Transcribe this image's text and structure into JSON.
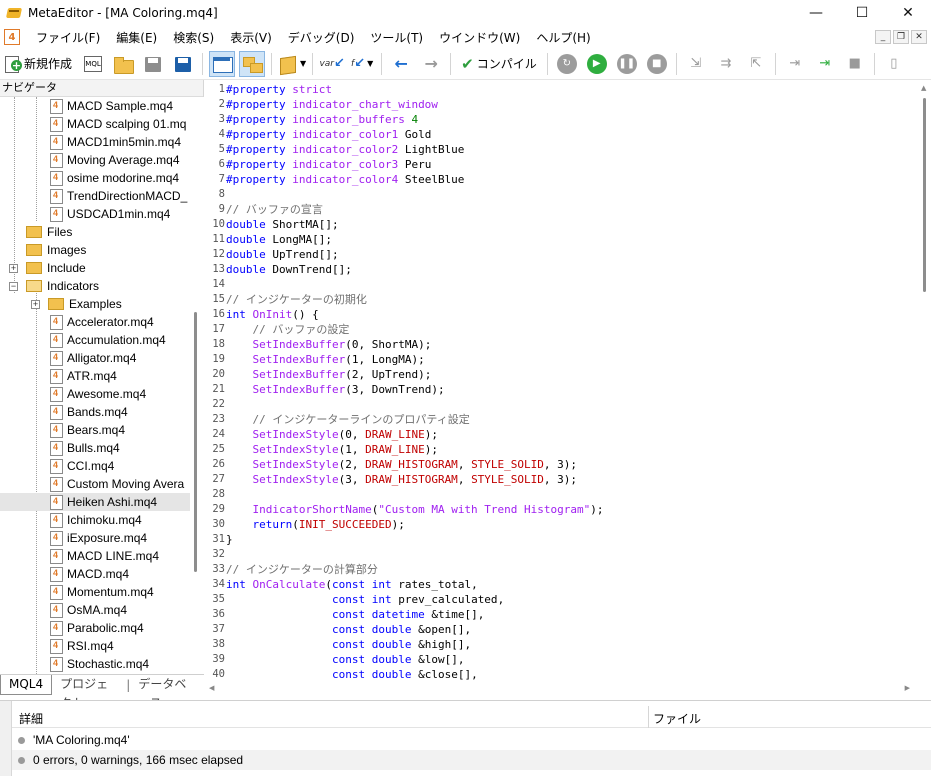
{
  "window": {
    "title": "MetaEditor - [MA Coloring.mq4]",
    "controls": {
      "minimize": "—",
      "maximize": "☐",
      "close": "✕"
    }
  },
  "menubar": {
    "items": [
      "ファイル(F)",
      "編集(E)",
      "検索(S)",
      "表示(V)",
      "デバッグ(D)",
      "ツール(T)",
      "ウインドウ(W)",
      "ヘルプ(H)"
    ],
    "mdi": {
      "minimize": "_",
      "restore": "❐",
      "close": "✕"
    }
  },
  "toolbar": {
    "new_label": "新規作成",
    "mq_label": "MQL",
    "var_label": "var",
    "func_label": "f",
    "compile_label": "コンパイル"
  },
  "navigator": {
    "header": "ナビゲータ",
    "top_files": [
      "MACD Sample.mq4",
      "MACD scalping 01.mq",
      "MACD1min5min.mq4",
      "Moving Average.mq4",
      "osime modorine.mq4",
      "TrendDirectionMACD_",
      "USDCAD1min.mq4"
    ],
    "folders": [
      "Files",
      "Images",
      "Include",
      "Indicators"
    ],
    "subfolder": "Examples",
    "indicator_files": [
      "Accelerator.mq4",
      "Accumulation.mq4",
      "Alligator.mq4",
      "ATR.mq4",
      "Awesome.mq4",
      "Bands.mq4",
      "Bears.mq4",
      "Bulls.mq4",
      "CCI.mq4",
      "Custom Moving Avera",
      "Heiken Ashi.mq4",
      "Ichimoku.mq4",
      "iExposure.mq4",
      "MACD LINE.mq4",
      "MACD.mq4",
      "Momentum.mq4",
      "OsMA.mq4",
      "Parabolic.mq4",
      "RSI.mq4",
      "Stochastic.mq4"
    ],
    "selected": "Heiken Ashi.mq4",
    "tabs": [
      "MQL4",
      "プロジェクト",
      "データベース"
    ],
    "tab_separator": "|"
  },
  "code": [
    {
      "n": "1",
      "t": "#property strict"
    },
    {
      "n": "2",
      "t": "#property indicator_chart_window"
    },
    {
      "n": "3",
      "t": "#property indicator_buffers 4"
    },
    {
      "n": "4",
      "t": "#property indicator_color1 Gold"
    },
    {
      "n": "5",
      "t": "#property indicator_color2 LightBlue"
    },
    {
      "n": "6",
      "t": "#property indicator_color3 Peru"
    },
    {
      "n": "7",
      "t": "#property indicator_color4 SteelBlue"
    },
    {
      "n": "8",
      "t": ""
    },
    {
      "n": "9",
      "t": "// バッファの宣言"
    },
    {
      "n": "10",
      "t": "double ShortMA[];"
    },
    {
      "n": "11",
      "t": "double LongMA[];"
    },
    {
      "n": "12",
      "t": "double UpTrend[];"
    },
    {
      "n": "13",
      "t": "double DownTrend[];"
    },
    {
      "n": "14",
      "t": ""
    },
    {
      "n": "15",
      "t": "// インジケーターの初期化"
    },
    {
      "n": "16",
      "t": "int OnInit() {"
    },
    {
      "n": "17",
      "t": "    // バッファの設定"
    },
    {
      "n": "18",
      "t": "    SetIndexBuffer(0, ShortMA);"
    },
    {
      "n": "19",
      "t": "    SetIndexBuffer(1, LongMA);"
    },
    {
      "n": "20",
      "t": "    SetIndexBuffer(2, UpTrend);"
    },
    {
      "n": "21",
      "t": "    SetIndexBuffer(3, DownTrend);"
    },
    {
      "n": "22",
      "t": ""
    },
    {
      "n": "23",
      "t": "    // インジケーターラインのプロパティ設定"
    },
    {
      "n": "24",
      "t": "    SetIndexStyle(0, DRAW_LINE);"
    },
    {
      "n": "25",
      "t": "    SetIndexStyle(1, DRAW_LINE);"
    },
    {
      "n": "26",
      "t": "    SetIndexStyle(2, DRAW_HISTOGRAM, STYLE_SOLID, 3);"
    },
    {
      "n": "27",
      "t": "    SetIndexStyle(3, DRAW_HISTOGRAM, STYLE_SOLID, 3);"
    },
    {
      "n": "28",
      "t": ""
    },
    {
      "n": "29",
      "t": "    IndicatorShortName(\"Custom MA with Trend Histogram\");"
    },
    {
      "n": "30",
      "t": "    return(INIT_SUCCEEDED);"
    },
    {
      "n": "31",
      "t": "}"
    },
    {
      "n": "32",
      "t": ""
    },
    {
      "n": "33",
      "t": "// インジケーターの計算部分"
    },
    {
      "n": "34",
      "t": "int OnCalculate(const int rates_total,"
    },
    {
      "n": "35",
      "t": "                const int prev_calculated,"
    },
    {
      "n": "36",
      "t": "                const datetime &time[],"
    },
    {
      "n": "37",
      "t": "                const double &open[],"
    },
    {
      "n": "38",
      "t": "                const double &high[],"
    },
    {
      "n": "39",
      "t": "                const double &low[],"
    },
    {
      "n": "40",
      "t": "                const double &close[],"
    }
  ],
  "syntax_colors": {
    "keyword": "#0000ff",
    "preprocessor": "#0000ff",
    "property_name": "#a020f0",
    "comment": "#707070",
    "function": "#a020f0",
    "constant": "#c00000",
    "string": "#a020f0",
    "number": "#008000",
    "plain": "#000000"
  },
  "bottom": {
    "col_details": "詳細",
    "col_file": "ファイル",
    "messages": [
      "'MA Coloring.mq4'",
      "0 errors, 0 warnings, 166 msec elapsed"
    ]
  }
}
